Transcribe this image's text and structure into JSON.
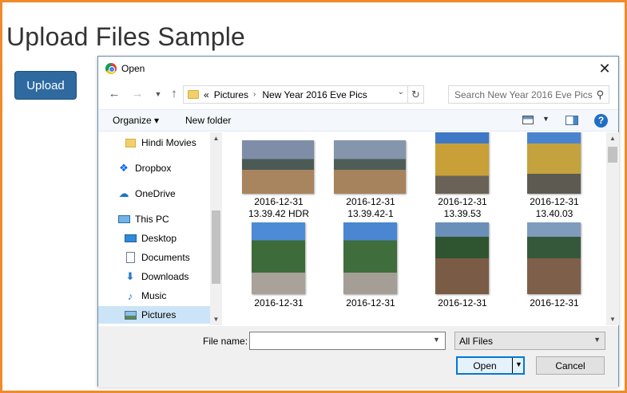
{
  "page": {
    "title": "Upload Files Sample",
    "upload_button": "Upload"
  },
  "dialog": {
    "title": "Open",
    "close_glyph": "✕",
    "nav": {
      "back": "←",
      "forward": "→",
      "recent": "⌄",
      "up": "↑"
    },
    "address": {
      "overflow": "«",
      "crumbs": [
        "Pictures",
        "New Year 2016 Eve Pics"
      ],
      "separator": "›"
    },
    "search": {
      "placeholder": "Search New Year 2016 Eve Pics"
    },
    "toolbar": {
      "organize": "Organize ▾",
      "new_folder": "New folder",
      "help": "?"
    },
    "nav_pane": {
      "items": [
        {
          "label": "Hindi Movies",
          "icon": "folder-icon"
        },
        {
          "label": "Dropbox",
          "icon": "dropbox-icon"
        },
        {
          "label": "OneDrive",
          "icon": "onedrive-icon"
        },
        {
          "label": "This PC",
          "icon": "computer-icon"
        },
        {
          "label": "Desktop",
          "icon": "desktop-icon"
        },
        {
          "label": "Documents",
          "icon": "documents-icon"
        },
        {
          "label": "Downloads",
          "icon": "downloads-icon"
        },
        {
          "label": "Music",
          "icon": "music-icon"
        },
        {
          "label": "Pictures",
          "icon": "pictures-icon",
          "selected": true
        }
      ]
    },
    "files": [
      {
        "line1": "2016-12-31",
        "line2": "13.39.42 HDR",
        "orientation": "landscape"
      },
      {
        "line1": "2016-12-31",
        "line2": "13.39.42-1",
        "orientation": "landscape"
      },
      {
        "line1": "2016-12-31",
        "line2": "13.39.53",
        "orientation": "portrait"
      },
      {
        "line1": "2016-12-31",
        "line2": "13.40.03",
        "orientation": "portrait"
      },
      {
        "line1": "2016-12-31",
        "line2": "",
        "orientation": "portrait"
      },
      {
        "line1": "2016-12-31",
        "line2": "",
        "orientation": "portrait"
      },
      {
        "line1": "2016-12-31",
        "line2": "",
        "orientation": "portrait"
      },
      {
        "line1": "2016-12-31",
        "line2": "",
        "orientation": "portrait"
      }
    ],
    "footer": {
      "file_name_label": "File name:",
      "file_name_value": "",
      "file_type": "All Files",
      "open": "Open",
      "cancel": "Cancel"
    }
  },
  "colors": {
    "frame": "#f08a2a",
    "upload_button": "#2e6aa0",
    "selected_nav": "#cce4f7",
    "accent": "#0078d7"
  }
}
